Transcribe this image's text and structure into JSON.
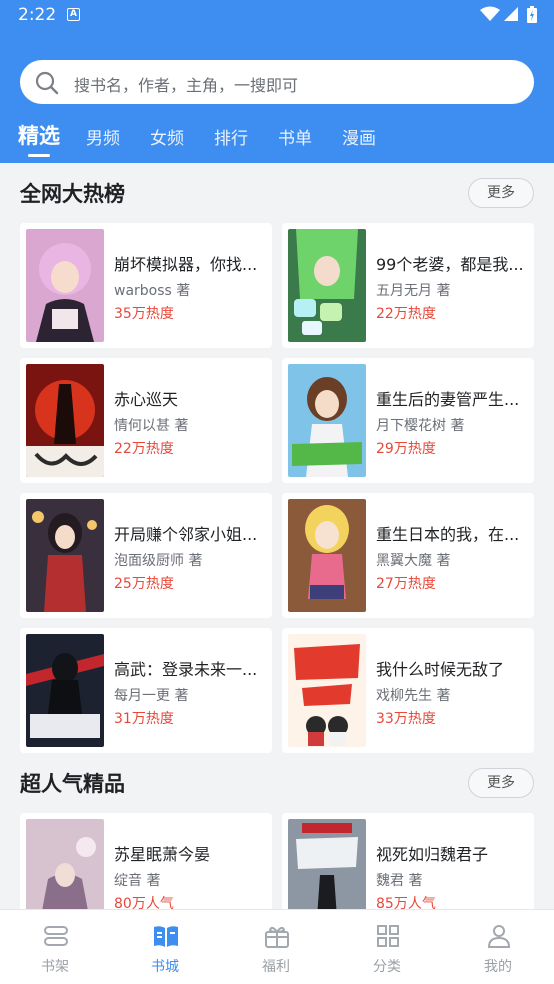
{
  "status_bar": {
    "time": "2:22",
    "notification_glyph": "A"
  },
  "search": {
    "placeholder": "搜书名，作者，主角，一搜即可"
  },
  "tabs": [
    {
      "label": "精选",
      "active": true
    },
    {
      "label": "男频"
    },
    {
      "label": "女频"
    },
    {
      "label": "排行"
    },
    {
      "label": "书单"
    },
    {
      "label": "漫画"
    }
  ],
  "sections": [
    {
      "title": "全网大热榜",
      "more_label": "更多",
      "books": [
        {
          "title": "崩坏模拟器，你找...",
          "author": "warboss 著",
          "heat": "35万热度"
        },
        {
          "title": "99个老婆，都是我...",
          "author": "五月无月 著",
          "heat": "22万热度"
        },
        {
          "title": "赤心巡天",
          "author": "情何以甚 著",
          "heat": "22万热度"
        },
        {
          "title": "重生后的妻管严生...",
          "author": "月下樱花树 著",
          "heat": "29万热度"
        },
        {
          "title": "开局赚个邻家小姐...",
          "author": "泡面级厨师 著",
          "heat": "25万热度"
        },
        {
          "title": "重生日本的我，在...",
          "author": "黑翼大魔 著",
          "heat": "27万热度"
        },
        {
          "title": "高武：登录未来一...",
          "author": "每月一更 著",
          "heat": "31万热度"
        },
        {
          "title": "我什么时候无敌了",
          "author": "戏柳先生 著",
          "heat": "33万热度"
        }
      ]
    },
    {
      "title": "超人气精品",
      "more_label": "更多",
      "books": [
        {
          "title": "苏星眠萧今晏",
          "author": "绽音 著",
          "heat": "80万人气"
        },
        {
          "title": "视死如归魏君子",
          "author": "魏君 著",
          "heat": "85万人气"
        }
      ]
    }
  ],
  "bottom_nav": [
    {
      "label": "书架",
      "icon": "bookshelf-icon"
    },
    {
      "label": "书城",
      "icon": "bookstore-icon",
      "active": true
    },
    {
      "label": "福利",
      "icon": "gift-icon"
    },
    {
      "label": "分类",
      "icon": "category-grid-icon"
    },
    {
      "label": "我的",
      "icon": "profile-icon"
    }
  ],
  "colors": {
    "primary": "#3d8ef0",
    "heat": "#e8483a",
    "background": "#f2f3f5"
  }
}
